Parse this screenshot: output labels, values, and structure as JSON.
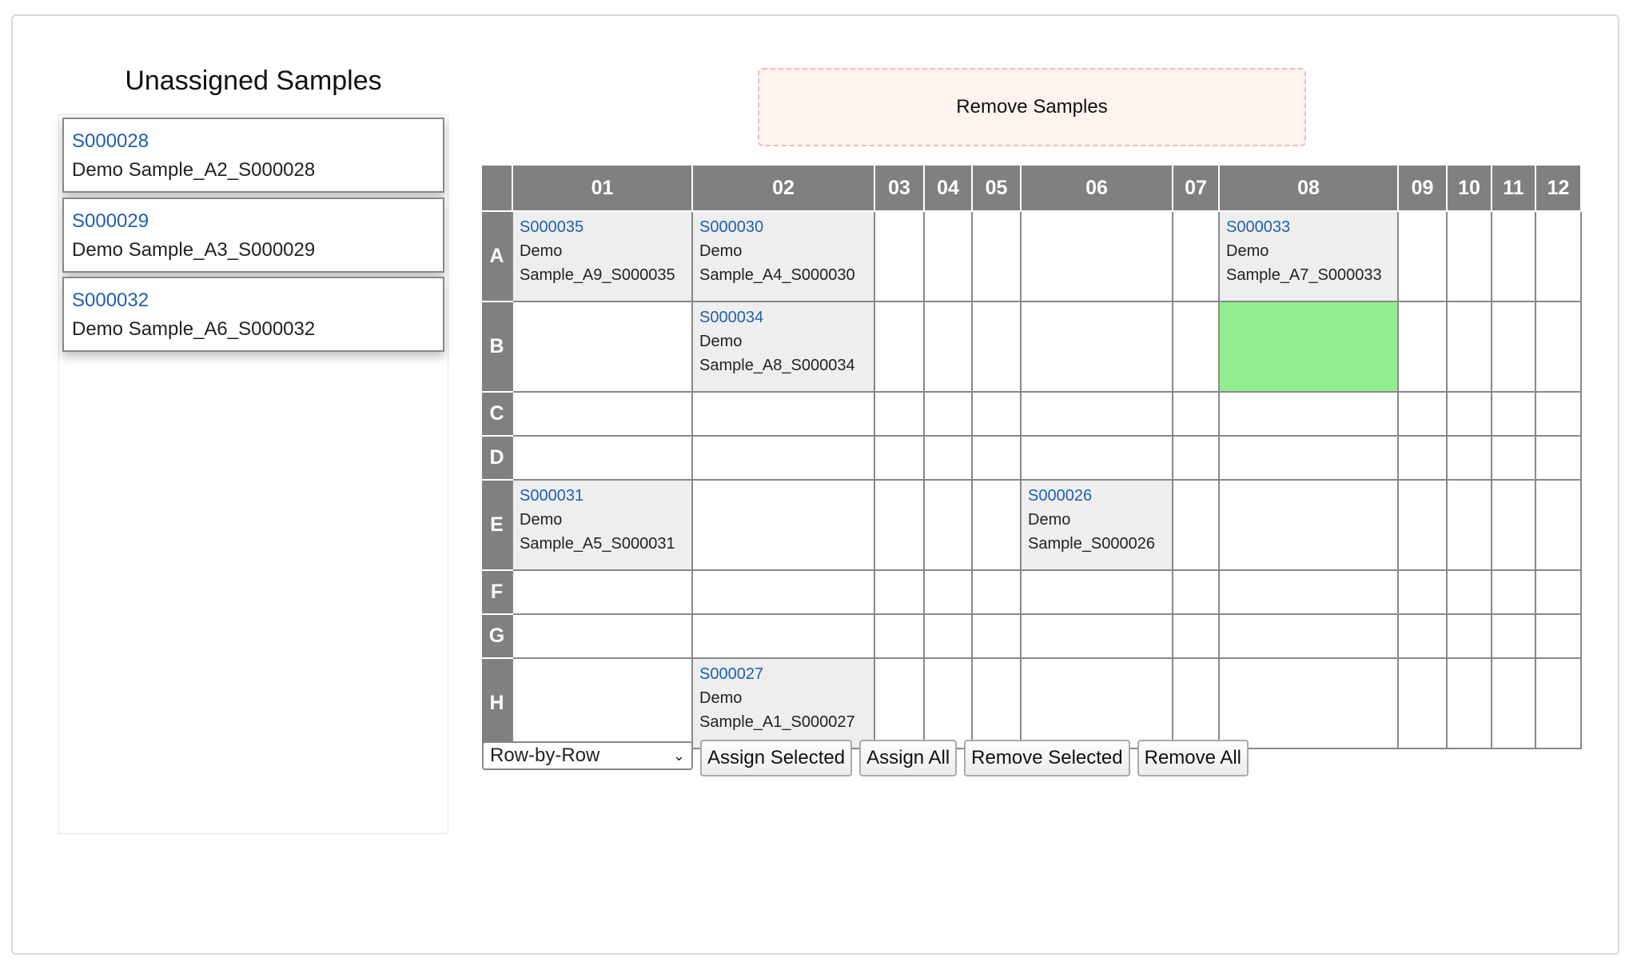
{
  "unassigned": {
    "title": "Unassigned Samples",
    "samples": [
      {
        "id": "S000028",
        "name": "Demo Sample_A2_S000028"
      },
      {
        "id": "S000029",
        "name": "Demo Sample_A3_S000029"
      },
      {
        "id": "S000032",
        "name": "Demo Sample_A6_S000032"
      }
    ]
  },
  "remove_zone": {
    "label": "Remove Samples"
  },
  "plate": {
    "columns": [
      "01",
      "02",
      "03",
      "04",
      "05",
      "06",
      "07",
      "08",
      "09",
      "10",
      "11",
      "12"
    ],
    "rows": [
      "A",
      "B",
      "C",
      "D",
      "E",
      "F",
      "G",
      "H"
    ],
    "wells": {
      "A01": {
        "id": "S000035",
        "name": "Demo Sample_A9_S000035"
      },
      "A02": {
        "id": "S000030",
        "name": "Demo Sample_A4_S000030"
      },
      "A08": {
        "id": "S000033",
        "name": "Demo Sample_A7_S000033"
      },
      "B02": {
        "id": "S000034",
        "name": "Demo Sample_A8_S000034"
      },
      "E01": {
        "id": "S000031",
        "name": "Demo Sample_A5_S000031"
      },
      "E06": {
        "id": "S000026",
        "name": "Demo Sample_S000026"
      },
      "H02": {
        "id": "S000027",
        "name": "Demo Sample_A1_S000027"
      }
    },
    "highlighted_well": "B08",
    "highlight_color": "#90ee90",
    "link_color": "#1f5fb0"
  },
  "controls": {
    "mode_select": "Row-by-Row",
    "assign_selected": "Assign Selected",
    "assign_all": "Assign All",
    "remove_selected": "Remove Selected",
    "remove_all": "Remove All"
  }
}
